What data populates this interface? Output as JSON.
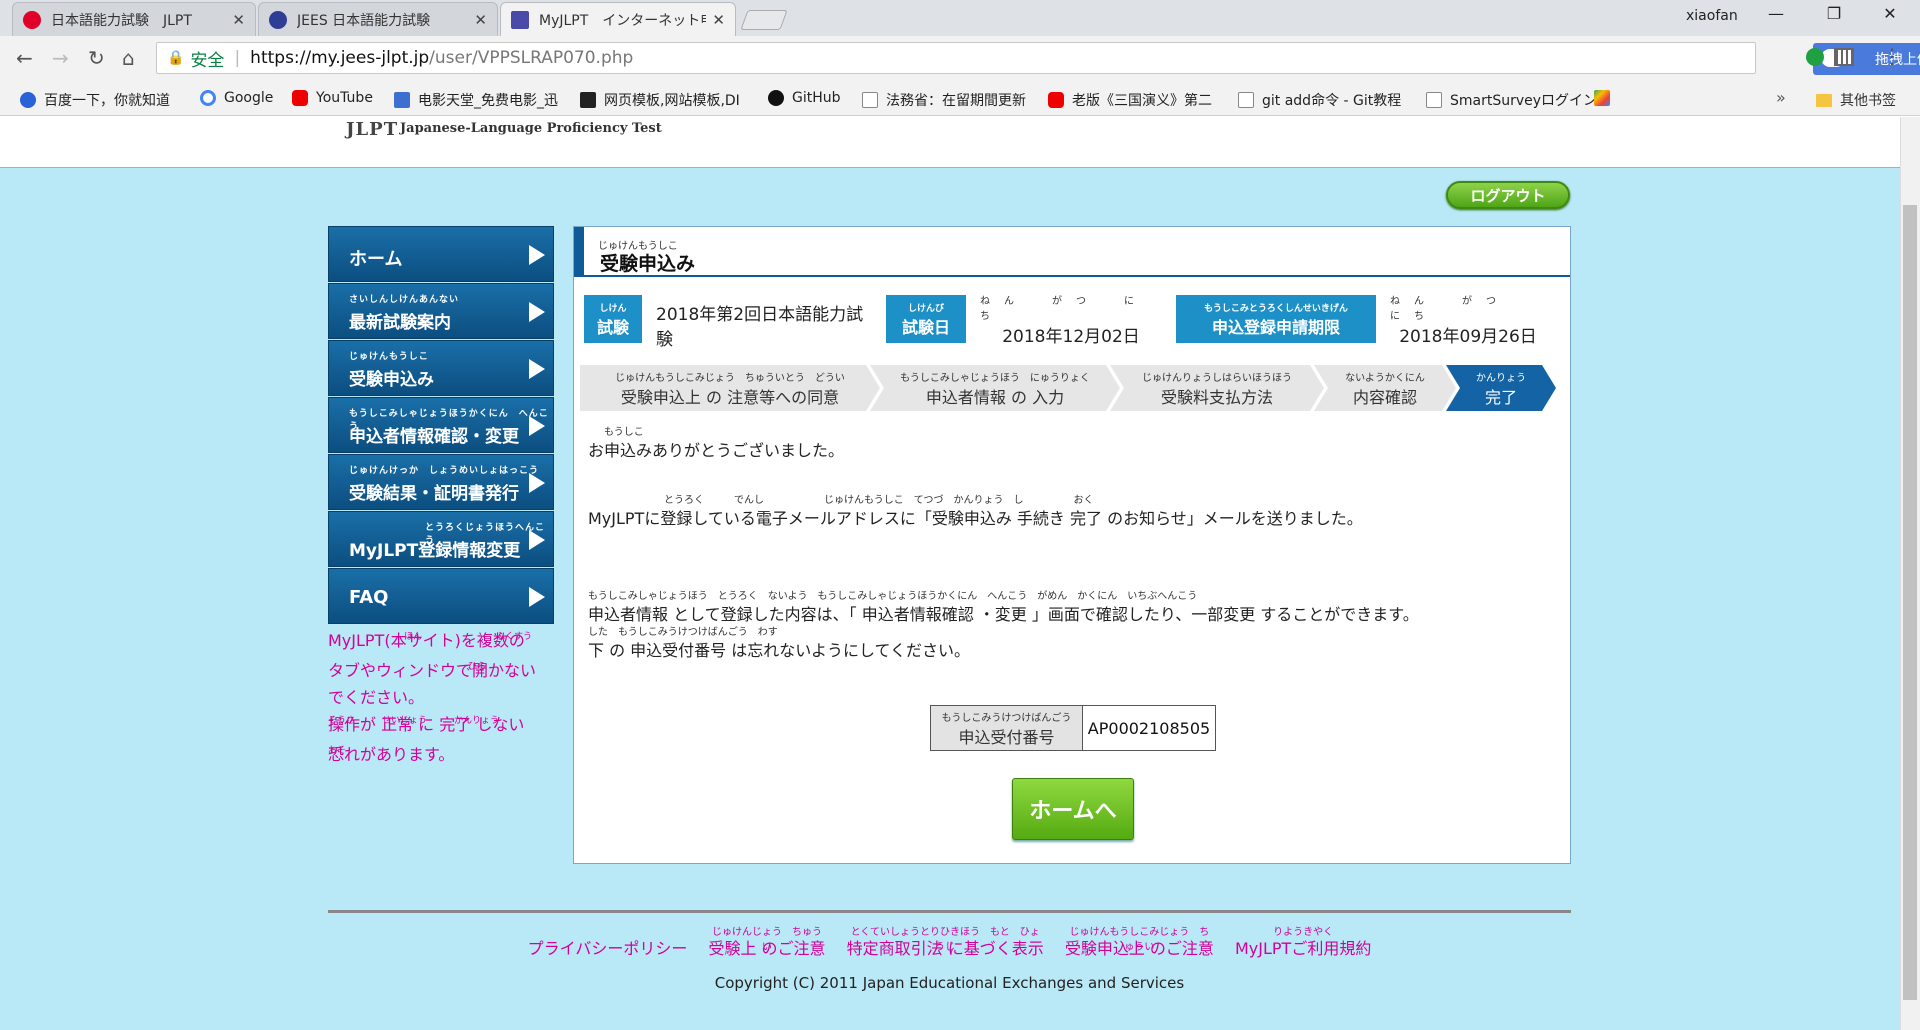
{
  "browser": {
    "tabs": [
      {
        "title": "日本語能力試験　JLPT"
      },
      {
        "title": "JEES 日本語能力試験"
      },
      {
        "title": "MyJLPT　インターネット申込"
      }
    ],
    "user": "xiaofan",
    "window_controls": {
      "minimize": "—",
      "maximize": "❐",
      "close": "✕"
    },
    "address": {
      "secure_label": "安全",
      "url_host": "https://my.jees-jlpt.jp",
      "url_path": "/user/VPPSLRAP070.php"
    },
    "extension_upload_label": "拖拽上传",
    "bookmarks": [
      {
        "label": "百度一下，你就知道"
      },
      {
        "label": "Google"
      },
      {
        "label": "YouTube"
      },
      {
        "label": "电影天堂_免费电影_迅"
      },
      {
        "label": "网页模板,网站模板,DI"
      },
      {
        "label": "GitHub"
      },
      {
        "label": "法務省：在留期間更新"
      },
      {
        "label": "老版《三国演义》第二"
      },
      {
        "label": "git add命令 - Git教程"
      },
      {
        "label": "SmartSurveyログイン"
      }
    ],
    "bookmarks_more": "»",
    "bookmarks_folder": "其他书签"
  },
  "site": {
    "logo": "JLPT",
    "logo_sub": "Japanese-Language Proficiency Test",
    "logout": "ログアウト"
  },
  "sidebar": {
    "items": [
      {
        "ruby": "",
        "label": "ホーム"
      },
      {
        "ruby": "さいしんしけんあんない",
        "label": "最新試験案内"
      },
      {
        "ruby": "じゅけんもうしこ",
        "label": "受験申込み"
      },
      {
        "ruby": "もうしこみしゃじょうほうかくにん　へんこう",
        "label": "申込者情報確認・変更"
      },
      {
        "ruby": "じゅけんけっか　しょうめいしょはっこう",
        "label": "受験結果・証明書発行"
      },
      {
        "ruby": "とうろくじょうほうへんこう",
        "label": "MyJLPT登録情報変更"
      },
      {
        "ruby": "",
        "label": "FAQ"
      }
    ],
    "warning": {
      "line1": "MyJLPT(本サイト)を複数の",
      "line2": "タブやウィンドウで開かない",
      "line3": "でください。",
      "line4": "操作が 正常 に 完了 しない",
      "line5": "恐れがあります。",
      "r1": "ほん",
      "r2": "ふくすう",
      "r3": "ひら",
      "r4": "そうさ",
      "r5": "せいじょう",
      "r6": "かんりょう",
      "r7": "おそ"
    }
  },
  "panel": {
    "title_ruby": "じゅけんもうしこ",
    "title": "受験申込み",
    "info": {
      "exam_label_ruby": "しけん",
      "exam_label": "試験",
      "exam_value": "2018年第2回日本語能力試験",
      "date_label_ruby": "しけんび",
      "date_label": "試験日",
      "date_ruby": "ねん　がつ　にち",
      "date_value": "2018年12月02日",
      "deadline_label_ruby": "もうしこみとうろくしんせいきげん",
      "deadline_label": "申込登録申請期限",
      "deadline_ruby": "ねん　がつ　にち",
      "deadline_value": "2018年09月26日"
    },
    "steps": [
      {
        "ruby": "じゅけんもうしこみじょう　ちゅういとう　どうい",
        "label": "受験申込上 の 注意等への同意"
      },
      {
        "ruby": "もうしこみしゃじょうほう　にゅうりょく",
        "label": "申込者情報 の 入力"
      },
      {
        "ruby": "じゅけんりょうしはらいほうほう",
        "label": "受験料支払方法"
      },
      {
        "ruby": "ないようかくにん",
        "label": "内容確認"
      },
      {
        "ruby": "かんりょう",
        "label": "完了"
      }
    ],
    "messages": {
      "thanks_ruby": "もうしこ",
      "thanks": "お申込みありがとうございました。",
      "email_ruby": "とうろく　　　でんし　　　　　　じゅけんもうしこ　てつづ　かんりょう　し　　　　　おく",
      "email": "MyJLPTに登録している電子メールアドレスに「受験申込み 手続き 完了 のお知らせ」メールを送りました。",
      "change_ruby": "もうしこみしゃじょうほう　とうろく　ないよう　もうしこみしゃじょうほうかくにん　へんこう　がめん　かくにん　いちぶへんこう",
      "change": "申込者情報 として登録した内容は、「 申込者情報確認 ・変更 」画面で確認したり、一部変更 することができます。",
      "keep_ruby": "した　もうしこみうけつけばんごう　わす",
      "keep": "下 の 申込受付番号 は忘れないようにしてください。"
    },
    "reception": {
      "label_ruby": "もうしこみうけつけばんごう",
      "label": "申込受付番号",
      "value": "AP0002108505"
    },
    "home_button": "ホームへ"
  },
  "footer": {
    "links": [
      {
        "ruby": "",
        "label": "プライバシーポリシー"
      },
      {
        "ruby": "じゅけんじょう　ちゅうい",
        "label": "受験上 のご注意"
      },
      {
        "ruby": "とくていしょうとりひきほう　もと　ひょうじ",
        "label": "特定商取引法 に基づく表示"
      },
      {
        "ruby": "じゅけんもうしこみじょう　ちゅうい",
        "label": "受験申込上 のご注意"
      },
      {
        "ruby": "りようきやく",
        "label": "MyJLPTご利用規約"
      }
    ],
    "copyright": "Copyright (C) 2011 Japan Educational Exchanges and Services"
  },
  "colors": {
    "page_bg": "#b9e8f6",
    "nav_blue": "#0f5b97",
    "accent_pink": "#d4009a",
    "button_green": "#55ab10"
  }
}
